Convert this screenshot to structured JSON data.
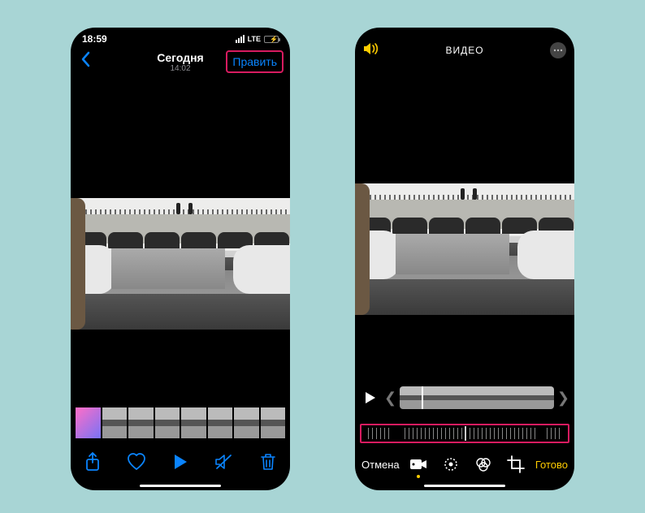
{
  "left": {
    "status": {
      "time": "18:59",
      "carrier": "LTE"
    },
    "header": {
      "title": "Сегодня",
      "subtitle": "14:02",
      "edit": "Править"
    },
    "toolbar": {
      "share": "share-icon",
      "favorite": "heart-icon",
      "play": "play-icon",
      "mute": "speaker-slash-icon",
      "delete": "trash-icon"
    }
  },
  "right": {
    "header": {
      "title": "ВИДЕО"
    },
    "bottom": {
      "cancel": "Отмена",
      "done": "Готово"
    },
    "tools": {
      "video": "video-icon",
      "adjust": "adjust-icon",
      "filters": "filters-icon",
      "crop": "crop-icon"
    }
  }
}
